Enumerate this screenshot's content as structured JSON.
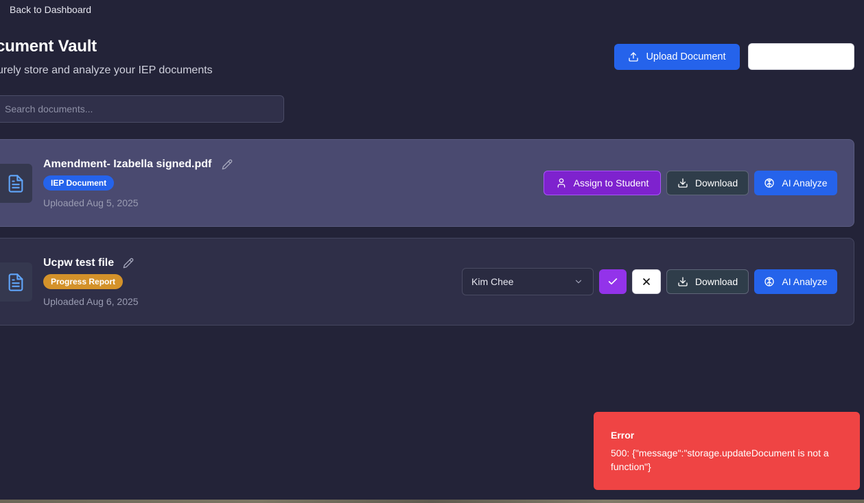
{
  "nav": {
    "back_label": "Back to Dashboard"
  },
  "header": {
    "title": "cument Vault",
    "subtitle": "urely store and analyze your IEP documents",
    "upload_label": "Upload Document",
    "secondary_button_label": ""
  },
  "search": {
    "placeholder": "Search documents...",
    "value": ""
  },
  "documents": [
    {
      "name": "Amendment- Izabella signed.pdf",
      "type": "IEP Document",
      "uploaded": "Uploaded Aug 5, 2025",
      "actions": {
        "assign_label": "Assign to Student",
        "download_label": "Download",
        "analyze_label": "AI Analyze"
      }
    },
    {
      "name": "Ucpw test file",
      "type": "Progress Report",
      "uploaded": "Uploaded Aug 6, 2025",
      "student_select": {
        "selected": "Kim Chee"
      },
      "actions": {
        "download_label": "Download",
        "analyze_label": "AI Analyze"
      }
    }
  ],
  "toast": {
    "title": "Error",
    "message": "500: {\"message\":\"storage.updateDocument is not a function\"}"
  },
  "colors": {
    "background": "#232338",
    "primary": "#2563eb",
    "purple": "#7e22ce",
    "iep_badge": "#2563eb",
    "progress_badge": "#d4922a",
    "error": "#ef4444"
  },
  "icons": {
    "upload": "upload-icon",
    "document": "file-text-icon",
    "pencil": "pencil-icon",
    "user": "user-icon",
    "download": "download-icon",
    "brain": "brain-icon",
    "chevron": "chevron-down-icon",
    "check": "check-icon",
    "close": "close-icon"
  }
}
